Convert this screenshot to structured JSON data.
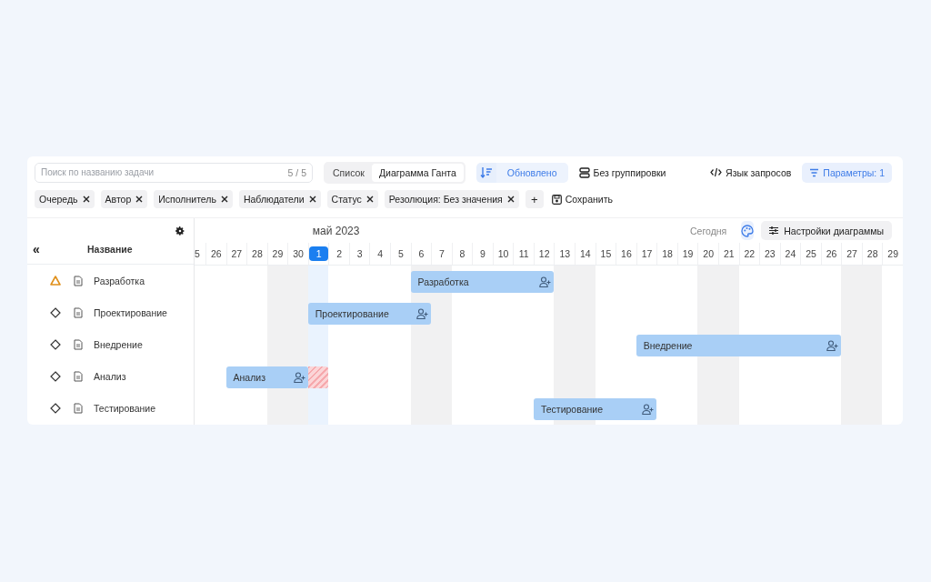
{
  "toolbar": {
    "search": {
      "placeholder": "Поиск по названию задачи",
      "count": "5 / 5"
    },
    "view_tabs": [
      {
        "label": "Список",
        "selected": false
      },
      {
        "label": "Диаграмма Ганта",
        "selected": true
      }
    ],
    "sort": {
      "label": "Обновлено"
    },
    "grouping": "Без группировки",
    "query_language": "Язык запросов",
    "parameters": "Параметры: 1"
  },
  "filters": [
    {
      "label": "Очередь"
    },
    {
      "label": "Автор"
    },
    {
      "label": "Исполнитель"
    },
    {
      "label": "Наблюдатели"
    },
    {
      "label": "Статус"
    },
    {
      "label": "Резолюция: Без значения"
    }
  ],
  "add_filter": "+",
  "save": "Сохранить",
  "gantt": {
    "collapse": "«",
    "name_column": "Название",
    "month": "май 2023",
    "today_button": "Сегодня",
    "settings": "Настройки диаграммы",
    "days": [
      {
        "label": "5",
        "weekend": false,
        "today": false
      },
      {
        "label": "26",
        "weekend": false,
        "today": false
      },
      {
        "label": "27",
        "weekend": false,
        "today": false
      },
      {
        "label": "28",
        "weekend": false,
        "today": false
      },
      {
        "label": "29",
        "weekend": true,
        "today": false
      },
      {
        "label": "30",
        "weekend": true,
        "today": false
      },
      {
        "label": "1",
        "weekend": false,
        "today": true
      },
      {
        "label": "2",
        "weekend": false,
        "today": false
      },
      {
        "label": "3",
        "weekend": false,
        "today": false
      },
      {
        "label": "4",
        "weekend": false,
        "today": false
      },
      {
        "label": "5",
        "weekend": false,
        "today": false
      },
      {
        "label": "6",
        "weekend": true,
        "today": false
      },
      {
        "label": "7",
        "weekend": true,
        "today": false
      },
      {
        "label": "8",
        "weekend": false,
        "today": false
      },
      {
        "label": "9",
        "weekend": false,
        "today": false
      },
      {
        "label": "10",
        "weekend": false,
        "today": false
      },
      {
        "label": "11",
        "weekend": false,
        "today": false
      },
      {
        "label": "12",
        "weekend": false,
        "today": false
      },
      {
        "label": "13",
        "weekend": true,
        "today": false
      },
      {
        "label": "14",
        "weekend": true,
        "today": false
      },
      {
        "label": "15",
        "weekend": false,
        "today": false
      },
      {
        "label": "16",
        "weekend": false,
        "today": false
      },
      {
        "label": "17",
        "weekend": false,
        "today": false
      },
      {
        "label": "18",
        "weekend": false,
        "today": false
      },
      {
        "label": "19",
        "weekend": false,
        "today": false
      },
      {
        "label": "20",
        "weekend": true,
        "today": false
      },
      {
        "label": "21",
        "weekend": true,
        "today": false
      },
      {
        "label": "22",
        "weekend": false,
        "today": false
      },
      {
        "label": "23",
        "weekend": false,
        "today": false
      },
      {
        "label": "24",
        "weekend": false,
        "today": false
      },
      {
        "label": "25",
        "weekend": false,
        "today": false
      },
      {
        "label": "26",
        "weekend": false,
        "today": false
      },
      {
        "label": "27",
        "weekend": true,
        "today": false
      },
      {
        "label": "28",
        "weekend": true,
        "today": false
      },
      {
        "label": "29",
        "weekend": false,
        "today": false
      }
    ],
    "tasks": [
      {
        "name": "Разработка",
        "kind": "warning",
        "bar": {
          "label": "Разработка"
        }
      },
      {
        "name": "Проектирование",
        "kind": "milestone",
        "bar": {
          "label": "Проектирование"
        }
      },
      {
        "name": "Внедрение",
        "kind": "milestone",
        "bar": {
          "label": "Внедрение"
        }
      },
      {
        "name": "Анализ",
        "kind": "milestone",
        "bar": {
          "label": "Анализ",
          "overdue": true
        }
      },
      {
        "name": "Тестирование",
        "kind": "milestone",
        "bar": {
          "label": "Тестирование"
        }
      }
    ]
  }
}
